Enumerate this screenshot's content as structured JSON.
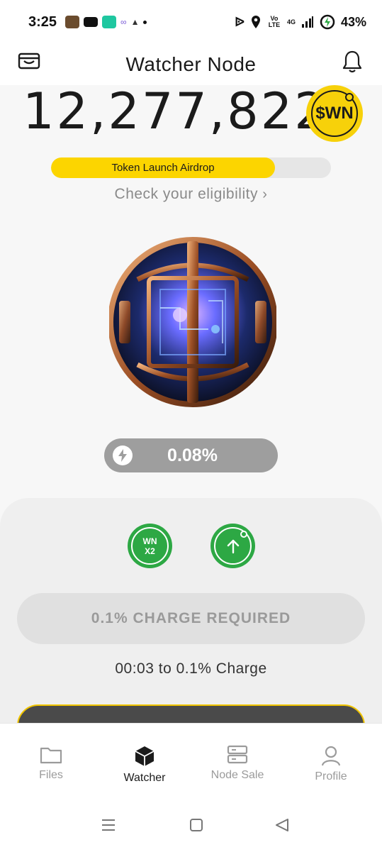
{
  "status_bar": {
    "time": "3:25",
    "battery": "43%",
    "network": "4G",
    "volte": "Vo LTE"
  },
  "header": {
    "title": "Watcher Node",
    "left_icon": "wallet-icon",
    "right_icon": "bell-icon"
  },
  "balance": {
    "amount": "12,277,822",
    "token": "$WN"
  },
  "airdrop": {
    "label": "Token Launch Airdrop",
    "progress": 0.8,
    "link_text": "Check your eligibility",
    "accent": "#fcd500"
  },
  "charge": {
    "percent": "0.08%",
    "required_label": "0.1% CHARGE REQUIRED",
    "countdown": "00:03 to 0.1% Charge"
  },
  "actions": {
    "boost": {
      "line1": "WN",
      "line2": "X2"
    },
    "upgrade_icon": "arrow-up-icon",
    "color": "#2da844"
  },
  "nav": {
    "items": [
      {
        "label": "Files",
        "icon": "folder-icon"
      },
      {
        "label": "Watcher",
        "icon": "cube-icon",
        "active": true
      },
      {
        "label": "Node Sale",
        "icon": "server-icon"
      },
      {
        "label": "Profile",
        "icon": "person-icon"
      }
    ]
  }
}
